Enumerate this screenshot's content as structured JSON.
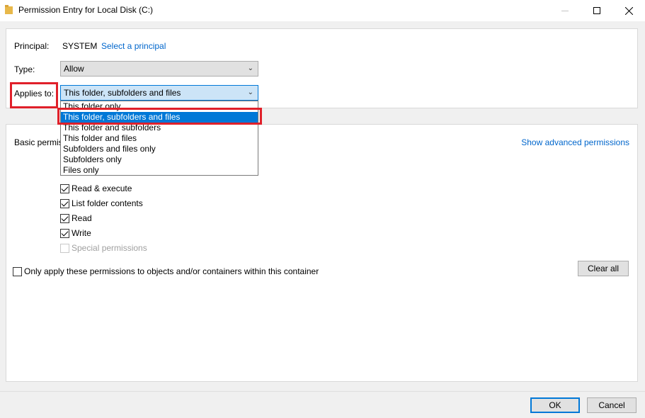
{
  "window": {
    "title": "Permission Entry for Local Disk (C:)",
    "minimize_glyph": "—",
    "maximize_glyph": "☐",
    "close_glyph": "✕"
  },
  "principal": {
    "label": "Principal:",
    "value": "SYSTEM",
    "link": "Select a principal"
  },
  "type": {
    "label": "Type:",
    "value": "Allow"
  },
  "applies_to": {
    "label": "Applies to:",
    "value": "This folder, subfolders and files",
    "options": [
      "This folder only",
      "This folder, subfolders and files",
      "This folder and subfolders",
      "This folder and files",
      "Subfolders and files only",
      "Subfolders only",
      "Files only"
    ],
    "selected_index": 1
  },
  "basic_permissions": {
    "heading": "Basic permissions:",
    "advanced_link": "Show advanced permissions",
    "items": [
      {
        "label": "Read & execute",
        "checked": true,
        "disabled": false
      },
      {
        "label": "List folder contents",
        "checked": true,
        "disabled": false
      },
      {
        "label": "Read",
        "checked": true,
        "disabled": false
      },
      {
        "label": "Write",
        "checked": true,
        "disabled": false
      },
      {
        "label": "Special permissions",
        "checked": false,
        "disabled": true
      }
    ]
  },
  "only_apply": {
    "label": "Only apply these permissions to objects and/or containers within this container",
    "checked": false
  },
  "buttons": {
    "clear_all": "Clear all",
    "ok": "OK",
    "cancel": "Cancel"
  },
  "colors": {
    "highlight": "#e0202a",
    "selection": "#0078d7",
    "link": "#0066cc"
  }
}
